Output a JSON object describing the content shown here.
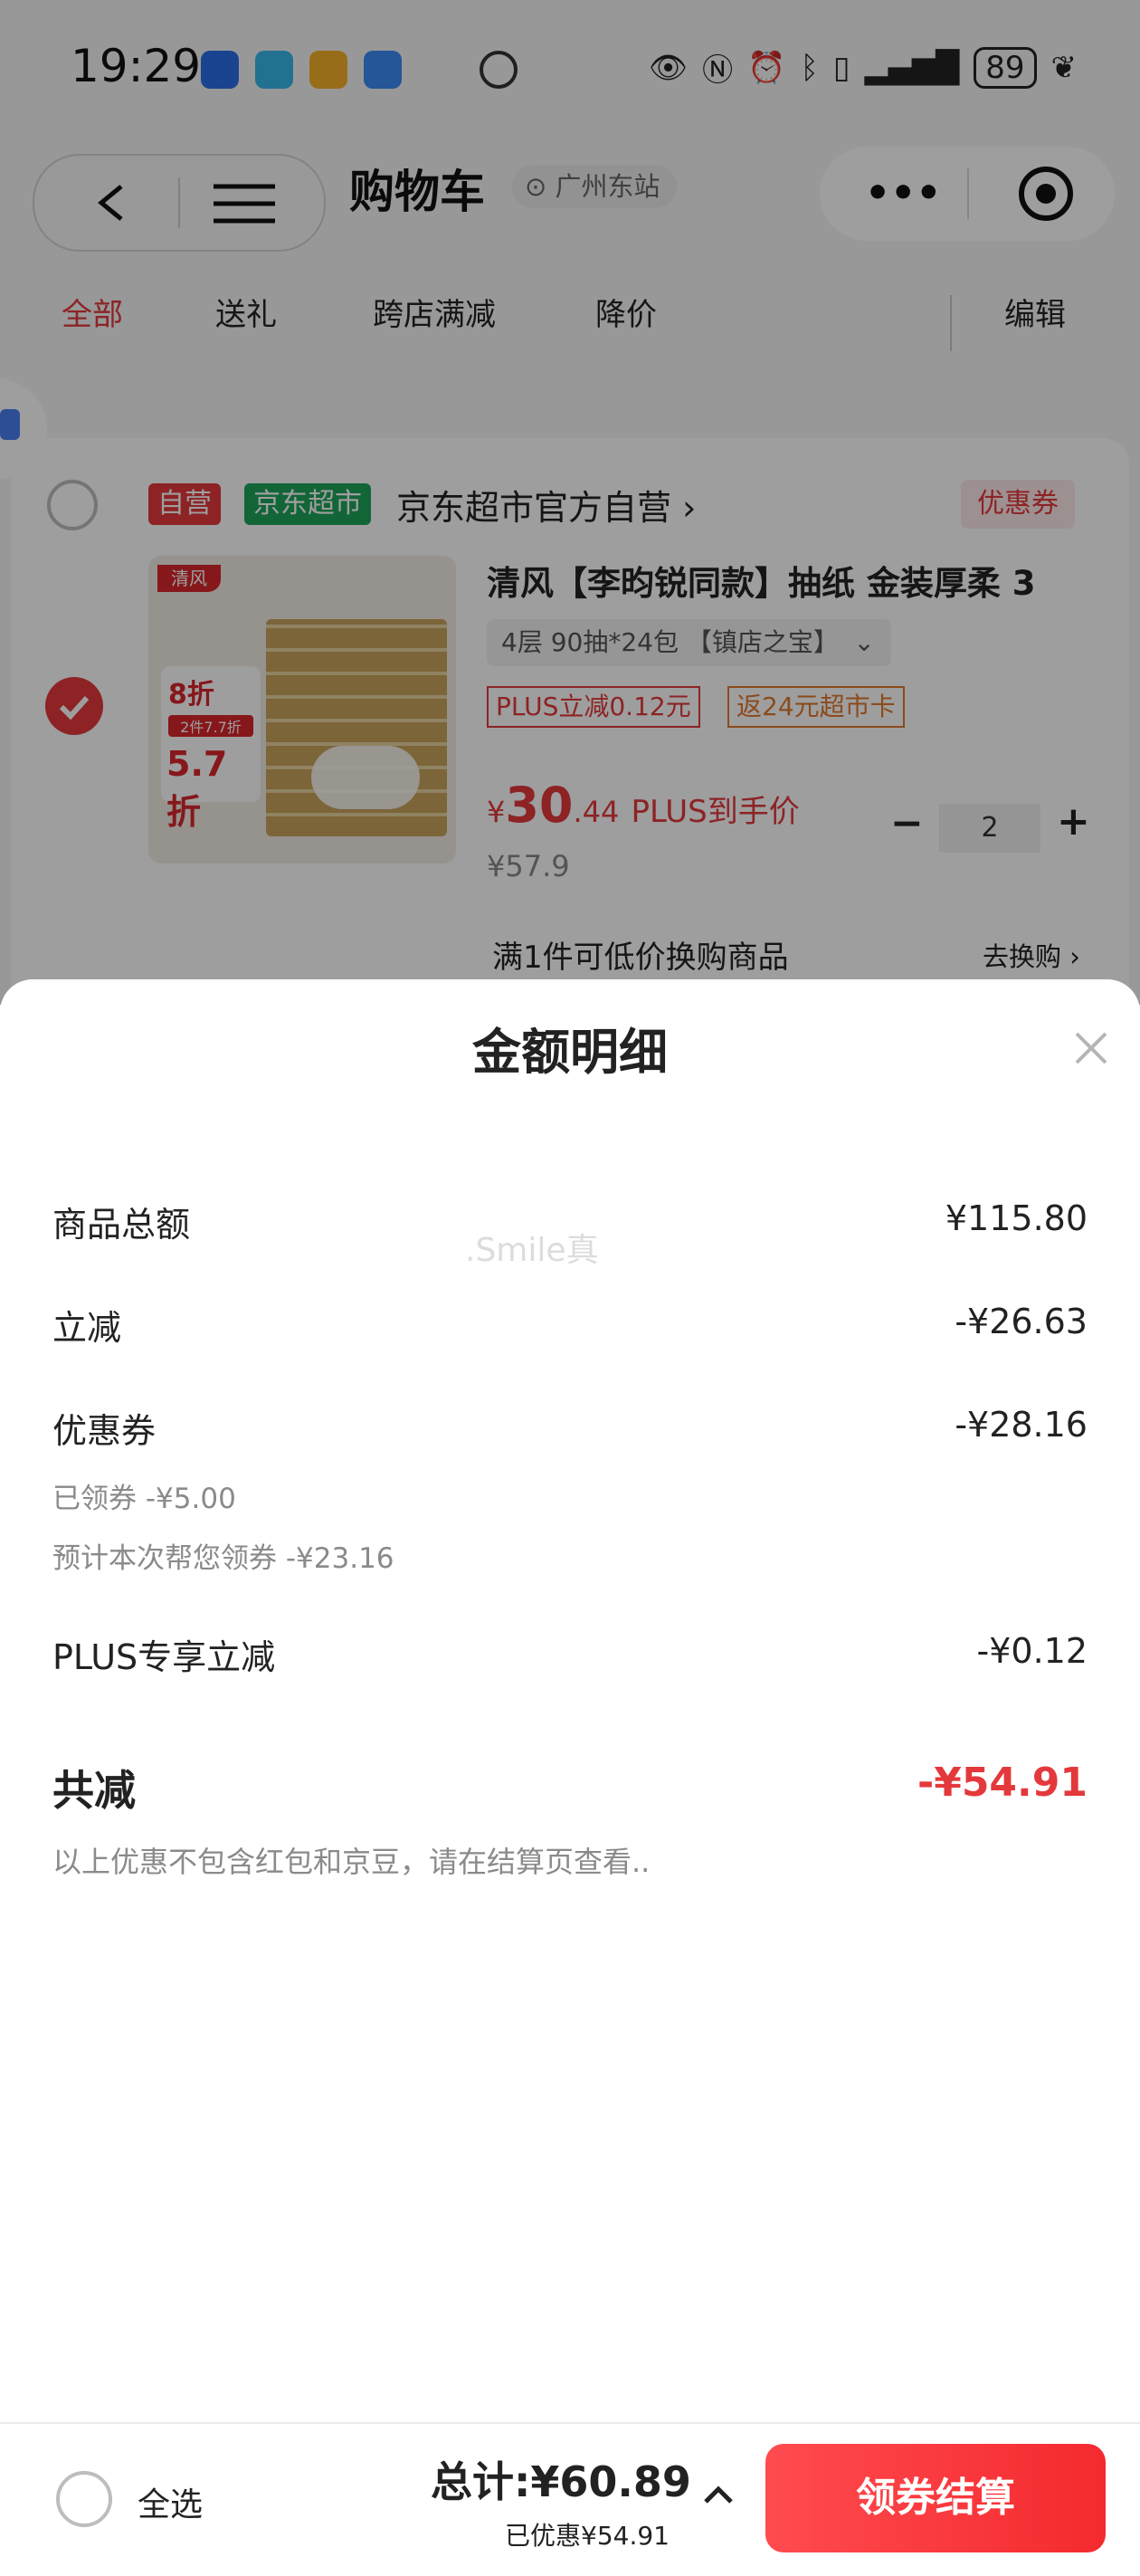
{
  "status_bar": {
    "time": "19:29",
    "battery": "89"
  },
  "header": {
    "title": "购物车",
    "location": "广州东站"
  },
  "tabs": [
    {
      "label": "全部",
      "active": true
    },
    {
      "label": "送礼"
    },
    {
      "label": "跨店满减"
    },
    {
      "label": "降价"
    }
  ],
  "edit_label": "编辑",
  "shop": {
    "tag_self": "自营",
    "tag_market": "京东超市",
    "name": "京东超市官方自营 ›",
    "coupon_tag": "优惠券"
  },
  "product": {
    "title": "清风【李昀锐同款】抽纸 金装厚柔 3",
    "spec": "4层 90抽*24包 【镇店之宝】",
    "tag_plus": "PLUS立减0.12元",
    "tag_card": "返24元超市卡",
    "price_symbol": "¥",
    "price_int": "30",
    "price_dec": ".44",
    "price_note": "PLUS到手价",
    "original_price": "¥57.9",
    "quantity": "2",
    "minus": "−",
    "plus": "+",
    "image_badge_1": "8折",
    "image_badge_2": "2件7.7折",
    "image_badge_3": "5.7折",
    "image_brand": "清风"
  },
  "exchange": {
    "text": "满1件可低价换购商品",
    "link": "去换购 ›"
  },
  "sheet": {
    "title": "金额明细",
    "watermark": ".Smile真",
    "rows": [
      {
        "label": "商品总额",
        "value": "¥115.80"
      },
      {
        "label": "立减",
        "value": "-¥26.63"
      },
      {
        "label": "优惠券",
        "value": "-¥28.16"
      },
      {
        "label": "PLUS专享立减",
        "value": "-¥0.12"
      }
    ],
    "coupon_sub": [
      "已领券 -¥5.00",
      "预计本次帮您领券 -¥23.16"
    ],
    "total_label": "共减",
    "total_value": "-¥54.91",
    "note": "以上优惠不包含红包和京豆，请在结算页查看.."
  },
  "bottom_bar": {
    "select_all": "全选",
    "sum": "总计:¥60.89",
    "saved": "已优惠¥54.91",
    "checkout": "领券结算"
  },
  "colors": {
    "accent": "#e4393c",
    "market_green": "#1ea35a",
    "mask": "rgba(0,0,0,0.38)"
  }
}
